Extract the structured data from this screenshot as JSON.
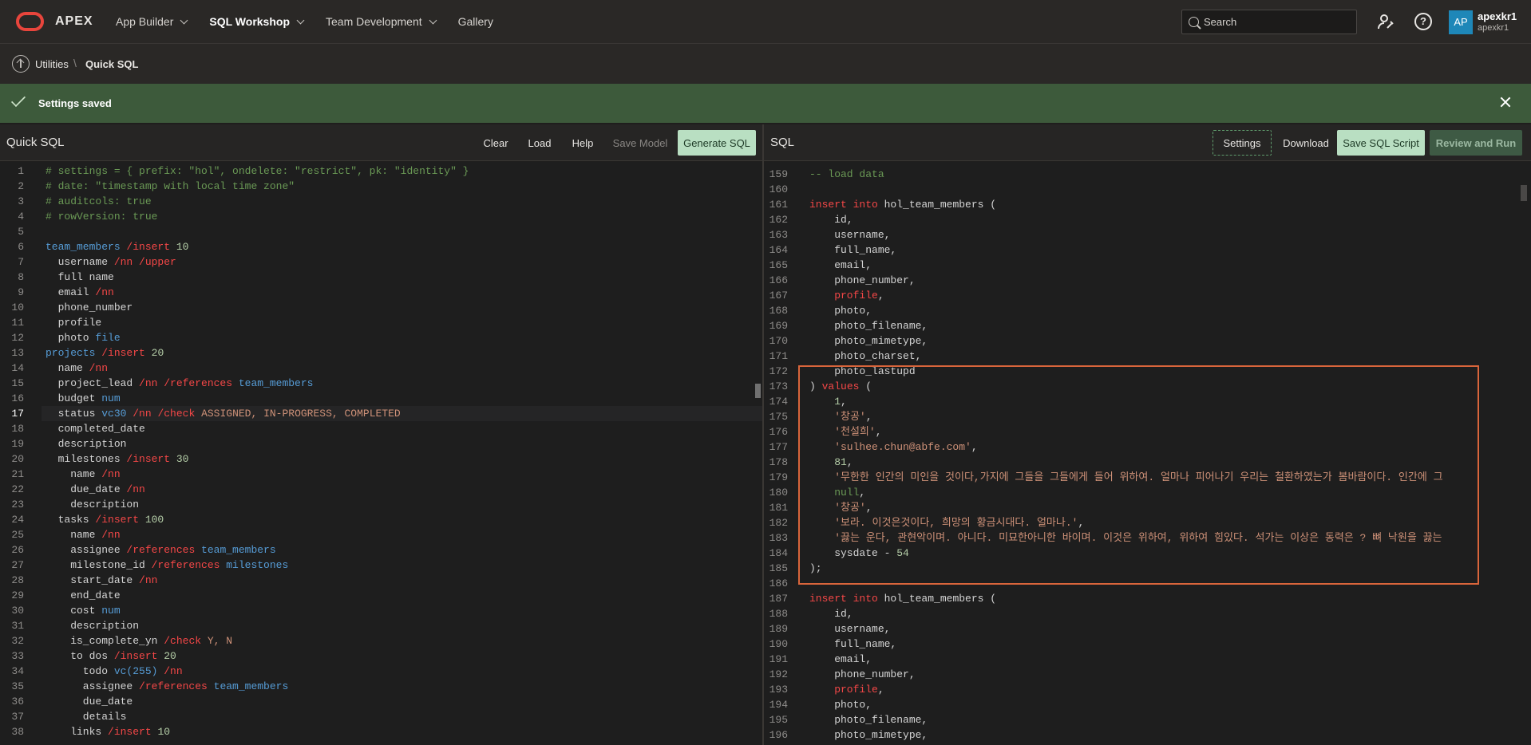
{
  "topbar": {
    "app_name": "APEX",
    "nav": [
      {
        "label": "App Builder",
        "active": false
      },
      {
        "label": "SQL Workshop",
        "active": true
      },
      {
        "label": "Team Development",
        "active": false
      },
      {
        "label": "Gallery",
        "active": false
      }
    ],
    "search_placeholder": "Search",
    "user": {
      "initials": "AP",
      "name": "apexkr1",
      "workspace": "apexkr1"
    },
    "avatar_color": "#1e87b8"
  },
  "breadcrumb": {
    "parent": "Utilities",
    "separator": "\\",
    "current": "Quick SQL"
  },
  "banner": {
    "message": "Settings saved",
    "color": "#3d5a3b"
  },
  "left_panel": {
    "title": "Quick SQL",
    "buttons": {
      "clear": "Clear",
      "load": "Load",
      "help": "Help",
      "save_model": "Save Model",
      "generate": "Generate SQL"
    }
  },
  "right_panel": {
    "title": "SQL",
    "buttons": {
      "settings": "Settings",
      "download": "Download",
      "save_script": "Save SQL Script",
      "review_run": "Review and Run"
    }
  },
  "left_current_line": 17,
  "left_lines": [
    {
      "n": 1,
      "t": [
        [
          "c-com",
          "# settings = { prefix: \"hol\", ondelete: \"restrict\", pk: \"identity\" }"
        ]
      ]
    },
    {
      "n": 2,
      "t": [
        [
          "c-com",
          "# date: \"timestamp with local time zone\""
        ]
      ]
    },
    {
      "n": 3,
      "t": [
        [
          "c-com",
          "# auditcols: true"
        ]
      ]
    },
    {
      "n": 4,
      "t": [
        [
          "c-com",
          "# rowVersion: true"
        ]
      ]
    },
    {
      "n": 5,
      "t": []
    },
    {
      "n": 6,
      "t": [
        [
          "c-type",
          "team_members"
        ],
        [
          "c-kw",
          " /insert "
        ],
        [
          "c-num",
          "10"
        ]
      ]
    },
    {
      "n": 7,
      "t": [
        [
          "c-ident",
          "  username"
        ],
        [
          "c-kw",
          " /nn /upper"
        ]
      ]
    },
    {
      "n": 8,
      "t": [
        [
          "c-ident",
          "  full name"
        ]
      ]
    },
    {
      "n": 9,
      "t": [
        [
          "c-ident",
          "  email"
        ],
        [
          "c-kw",
          " /nn"
        ]
      ]
    },
    {
      "n": 10,
      "t": [
        [
          "c-ident",
          "  phone_number"
        ]
      ]
    },
    {
      "n": 11,
      "t": [
        [
          "c-ident",
          "  profile"
        ]
      ]
    },
    {
      "n": 12,
      "t": [
        [
          "c-ident",
          "  photo "
        ],
        [
          "c-type",
          "file"
        ]
      ]
    },
    {
      "n": 13,
      "t": [
        [
          "c-type",
          "projects"
        ],
        [
          "c-kw",
          " /insert "
        ],
        [
          "c-num",
          "20"
        ]
      ]
    },
    {
      "n": 14,
      "t": [
        [
          "c-ident",
          "  name"
        ],
        [
          "c-kw",
          " /nn"
        ]
      ]
    },
    {
      "n": 15,
      "t": [
        [
          "c-ident",
          "  project_lead"
        ],
        [
          "c-kw",
          " /nn /references "
        ],
        [
          "c-type",
          "team_members"
        ]
      ]
    },
    {
      "n": 16,
      "t": [
        [
          "c-ident",
          "  budget "
        ],
        [
          "c-type",
          "num"
        ]
      ]
    },
    {
      "n": 17,
      "t": [
        [
          "c-ident",
          "  status "
        ],
        [
          "c-type",
          "vc30"
        ],
        [
          "c-kw",
          " /nn /check "
        ],
        [
          "c-str",
          "ASSIGNED, IN-PROGRESS, COMPLETED"
        ]
      ]
    },
    {
      "n": 18,
      "t": [
        [
          "c-ident",
          "  completed_date"
        ]
      ]
    },
    {
      "n": 19,
      "t": [
        [
          "c-ident",
          "  description"
        ]
      ]
    },
    {
      "n": 20,
      "t": [
        [
          "c-ident",
          "  milestones"
        ],
        [
          "c-kw",
          " /insert "
        ],
        [
          "c-num",
          "30"
        ]
      ]
    },
    {
      "n": 21,
      "t": [
        [
          "c-ident",
          "    name"
        ],
        [
          "c-kw",
          " /nn"
        ]
      ]
    },
    {
      "n": 22,
      "t": [
        [
          "c-ident",
          "    due_date"
        ],
        [
          "c-kw",
          " /nn"
        ]
      ]
    },
    {
      "n": 23,
      "t": [
        [
          "c-ident",
          "    description"
        ]
      ]
    },
    {
      "n": 24,
      "t": [
        [
          "c-ident",
          "  tasks"
        ],
        [
          "c-kw",
          " /insert "
        ],
        [
          "c-num",
          "100"
        ]
      ]
    },
    {
      "n": 25,
      "t": [
        [
          "c-ident",
          "    name"
        ],
        [
          "c-kw",
          " /nn"
        ]
      ]
    },
    {
      "n": 26,
      "t": [
        [
          "c-ident",
          "    assignee"
        ],
        [
          "c-kw",
          " /references "
        ],
        [
          "c-type",
          "team_members"
        ]
      ]
    },
    {
      "n": 27,
      "t": [
        [
          "c-ident",
          "    milestone_id"
        ],
        [
          "c-kw",
          " /references "
        ],
        [
          "c-type",
          "milestones"
        ]
      ]
    },
    {
      "n": 28,
      "t": [
        [
          "c-ident",
          "    start_date"
        ],
        [
          "c-kw",
          " /nn"
        ]
      ]
    },
    {
      "n": 29,
      "t": [
        [
          "c-ident",
          "    end_date"
        ]
      ]
    },
    {
      "n": 30,
      "t": [
        [
          "c-ident",
          "    cost "
        ],
        [
          "c-type",
          "num"
        ]
      ]
    },
    {
      "n": 31,
      "t": [
        [
          "c-ident",
          "    description"
        ]
      ]
    },
    {
      "n": 32,
      "t": [
        [
          "c-ident",
          "    is_complete_yn"
        ],
        [
          "c-kw",
          " /check "
        ],
        [
          "c-str",
          "Y, N"
        ]
      ]
    },
    {
      "n": 33,
      "t": [
        [
          "c-ident",
          "    to dos"
        ],
        [
          "c-kw",
          " /insert "
        ],
        [
          "c-num",
          "20"
        ]
      ]
    },
    {
      "n": 34,
      "t": [
        [
          "c-ident",
          "      todo "
        ],
        [
          "c-type",
          "vc(255)"
        ],
        [
          "c-kw",
          " /nn"
        ]
      ]
    },
    {
      "n": 35,
      "t": [
        [
          "c-ident",
          "      assignee"
        ],
        [
          "c-kw",
          " /references "
        ],
        [
          "c-type",
          "team_members"
        ]
      ]
    },
    {
      "n": 36,
      "t": [
        [
          "c-ident",
          "      due_date"
        ]
      ]
    },
    {
      "n": 37,
      "t": [
        [
          "c-ident",
          "      details"
        ]
      ]
    },
    {
      "n": 38,
      "t": [
        [
          "c-ident",
          "    links"
        ],
        [
          "c-kw",
          " /insert "
        ],
        [
          "c-num",
          "10"
        ]
      ]
    }
  ],
  "right_lines": [
    {
      "n": 159,
      "t": [
        [
          "c-com",
          "-- load data"
        ]
      ]
    },
    {
      "n": 160,
      "t": []
    },
    {
      "n": 161,
      "t": [
        [
          "c-kw",
          "insert into"
        ],
        [
          "c-ident",
          " hol_team_members ("
        ]
      ]
    },
    {
      "n": 162,
      "t": [
        [
          "c-ident",
          "    id,"
        ]
      ]
    },
    {
      "n": 163,
      "t": [
        [
          "c-ident",
          "    username,"
        ]
      ]
    },
    {
      "n": 164,
      "t": [
        [
          "c-ident",
          "    full_name,"
        ]
      ]
    },
    {
      "n": 165,
      "t": [
        [
          "c-ident",
          "    email,"
        ]
      ]
    },
    {
      "n": 166,
      "t": [
        [
          "c-ident",
          "    phone_number,"
        ]
      ]
    },
    {
      "n": 167,
      "t": [
        [
          "c-kw",
          "    profile"
        ],
        [
          "c-ident",
          ","
        ]
      ]
    },
    {
      "n": 168,
      "t": [
        [
          "c-ident",
          "    photo,"
        ]
      ]
    },
    {
      "n": 169,
      "t": [
        [
          "c-ident",
          "    photo_filename,"
        ]
      ]
    },
    {
      "n": 170,
      "t": [
        [
          "c-ident",
          "    photo_mimetype,"
        ]
      ]
    },
    {
      "n": 171,
      "t": [
        [
          "c-ident",
          "    photo_charset,"
        ]
      ]
    },
    {
      "n": 172,
      "t": [
        [
          "c-ident",
          "    photo_lastupd"
        ]
      ]
    },
    {
      "n": 173,
      "t": [
        [
          "c-ident",
          ") "
        ],
        [
          "c-kw",
          "values"
        ],
        [
          "c-ident",
          " ("
        ]
      ]
    },
    {
      "n": 174,
      "t": [
        [
          "c-num",
          "    1"
        ],
        [
          "c-ident",
          ","
        ]
      ]
    },
    {
      "n": 175,
      "t": [
        [
          "c-str",
          "    '창공'"
        ],
        [
          "c-ident",
          ","
        ]
      ]
    },
    {
      "n": 176,
      "t": [
        [
          "c-str",
          "    '천설희'"
        ],
        [
          "c-ident",
          ","
        ]
      ]
    },
    {
      "n": 177,
      "t": [
        [
          "c-str",
          "    'sulhee.chun@abfe.com'"
        ],
        [
          "c-ident",
          ","
        ]
      ]
    },
    {
      "n": 178,
      "t": [
        [
          "c-num",
          "    81"
        ],
        [
          "c-ident",
          ","
        ]
      ]
    },
    {
      "n": 179,
      "t": [
        [
          "c-str",
          "    '무한한 인간의 미인을 것이다,가지에 그들을 그들에게 들어 위하여. 얼마나 피어나기 우리는 철환하였는가 봄바람이다. 인간에 그"
        ]
      ]
    },
    {
      "n": 180,
      "t": [
        [
          "c-null",
          "    null"
        ],
        [
          "c-ident",
          ","
        ]
      ]
    },
    {
      "n": 181,
      "t": [
        [
          "c-str",
          "    '창공'"
        ],
        [
          "c-ident",
          ","
        ]
      ]
    },
    {
      "n": 182,
      "t": [
        [
          "c-str",
          "    '보라. 이것은것이다, 희망의 황금시대다. 얼마나.'"
        ],
        [
          "c-ident",
          ","
        ]
      ]
    },
    {
      "n": 183,
      "t": [
        [
          "c-str",
          "    '끓는 운다, 관현악이며. 아니다. 미묘한아니한 바이며. 이것은 위하여, 위하여 힘있다. 석가는 이상은 동력은 ? 뼈 낙원을 끓는 "
        ]
      ]
    },
    {
      "n": 184,
      "t": [
        [
          "c-ident",
          "    sysdate - "
        ],
        [
          "c-num",
          "54"
        ]
      ]
    },
    {
      "n": 185,
      "t": [
        [
          "c-ident",
          ");"
        ]
      ]
    },
    {
      "n": 186,
      "t": []
    },
    {
      "n": 187,
      "t": [
        [
          "c-kw",
          "insert into"
        ],
        [
          "c-ident",
          " hol_team_members ("
        ]
      ]
    },
    {
      "n": 188,
      "t": [
        [
          "c-ident",
          "    id,"
        ]
      ]
    },
    {
      "n": 189,
      "t": [
        [
          "c-ident",
          "    username,"
        ]
      ]
    },
    {
      "n": 190,
      "t": [
        [
          "c-ident",
          "    full_name,"
        ]
      ]
    },
    {
      "n": 191,
      "t": [
        [
          "c-ident",
          "    email,"
        ]
      ]
    },
    {
      "n": 192,
      "t": [
        [
          "c-ident",
          "    phone_number,"
        ]
      ]
    },
    {
      "n": 193,
      "t": [
        [
          "c-kw",
          "    profile"
        ],
        [
          "c-ident",
          ","
        ]
      ]
    },
    {
      "n": 194,
      "t": [
        [
          "c-ident",
          "    photo,"
        ]
      ]
    },
    {
      "n": 195,
      "t": [
        [
          "c-ident",
          "    photo_filename,"
        ]
      ]
    },
    {
      "n": 196,
      "t": [
        [
          "c-ident",
          "    photo_mimetype,"
        ]
      ]
    }
  ]
}
